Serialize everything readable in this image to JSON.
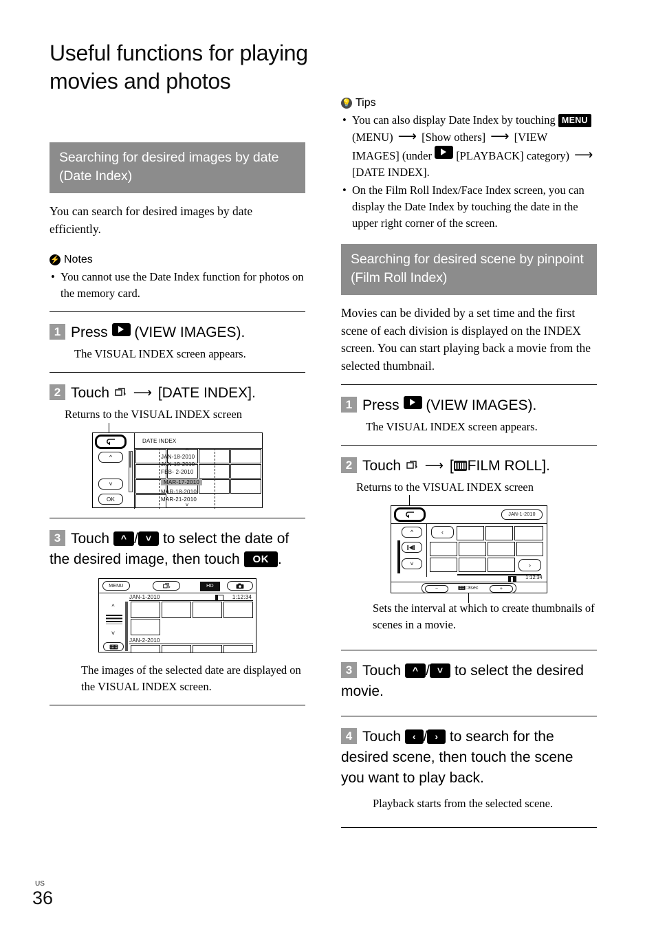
{
  "page": {
    "title": "Useful functions for playing movies and photos",
    "footer_region": "US",
    "footer_page": "36"
  },
  "left_column": {
    "section_header": "Searching for desired images by date (Date Index)",
    "intro": "You can search for desired images by date efficiently.",
    "notes": {
      "heading": "Notes",
      "items": [
        "You cannot use the Date Index function for photos on the memory card."
      ]
    },
    "steps": [
      {
        "num": "1",
        "text_before": "Press",
        "icon": "view-images-icon",
        "text_after": "(VIEW IMAGES).",
        "result": "The VISUAL INDEX screen appears."
      },
      {
        "num": "2",
        "text_before": "Touch",
        "icon": "show-others-icon",
        "arrow": "⟶",
        "text_after": "[DATE INDEX].",
        "result": "Returns to the VISUAL INDEX screen"
      },
      {
        "num": "3",
        "text_before": "Touch",
        "icon_up": "chevron-up-key",
        "separator": "/",
        "icon_down": "chevron-down-key",
        "text_mid": "to select the date of the desired image, then touch",
        "ok_label": "OK",
        "text_end": ".",
        "result": "The images of the selected date are displayed on the VISUAL INDEX screen."
      }
    ],
    "date_index_screen": {
      "title": "DATE INDEX",
      "back_label": "back-arrow",
      "up_label": "chevron-up",
      "down_label": "chevron-down",
      "ok_label": "OK",
      "dates": [
        "JAN-18-2010",
        "JAN-19-2010",
        "FEB- 2-2010",
        "MAR-17-2010",
        "MAR-18-2010",
        "MAR-21-2010"
      ],
      "selected_date": "MAR-17-2010"
    },
    "visual_index_screen": {
      "menu_label": "MENU",
      "quality_badge": "HD",
      "date_1": "JAN-1-2010",
      "duration": "1:12:34",
      "date_2": "JAN-2-2010"
    }
  },
  "right_column": {
    "tips": {
      "heading": "Tips",
      "item1_parts": {
        "a": "You can also display Date Index by touching",
        "menu_key": "MENU",
        "b": "(MENU)",
        "c": "[Show others]",
        "d": "[VIEW IMAGES] (under",
        "e": "[PLAYBACK] category)",
        "f": "[DATE INDEX]."
      },
      "item2": "On the Film Roll Index/Face Index screen, you can display the Date Index by touching the date in the upper right corner of the screen."
    },
    "section_header": "Searching for desired scene by pinpoint (Film Roll Index)",
    "intro": "Movies can be divided by a set time and the first scene of each division is displayed on the INDEX screen. You can start playing back a movie from the selected thumbnail.",
    "steps": [
      {
        "num": "1",
        "text_before": "Press",
        "icon": "view-images-icon",
        "text_after": "(VIEW IMAGES).",
        "result": "The VISUAL INDEX screen appears."
      },
      {
        "num": "2",
        "text_before": "Touch",
        "icon": "show-others-icon",
        "arrow": "⟶",
        "bracket_open": "[",
        "film_icon": "film-roll-icon",
        "text_after": "FILM ROLL].",
        "result": "Returns to the VISUAL INDEX screen",
        "caption": "Sets the interval at which to create thumbnails of scenes in a movie."
      },
      {
        "num": "3",
        "text_before": "Touch",
        "icon_up": "chevron-up-key",
        "separator": "/",
        "icon_down": "chevron-down-key",
        "text_mid": "to select the desired movie."
      },
      {
        "num": "4",
        "text_before": "Touch",
        "icon_left": "chevron-left-key",
        "separator": "/",
        "icon_right": "chevron-right-key",
        "text_mid": "to search for the desired scene, then touch the scene you want to play back.",
        "result": "Playback starts from the selected scene."
      }
    ],
    "film_roll_screen": {
      "back_label": "back-arrow",
      "date_badge": "JAN-1-2010",
      "duration": "1:12:34",
      "interval_label": ":3sec",
      "minus_label": "−",
      "plus_label": "+",
      "left_nav": "‹",
      "right_nav": "›"
    }
  },
  "colors": {
    "section_bar": "#8c8c8c",
    "step_num_bg": "#9a9a9a",
    "key_bg": "#000000",
    "selected_row": "#a8a8a8"
  }
}
